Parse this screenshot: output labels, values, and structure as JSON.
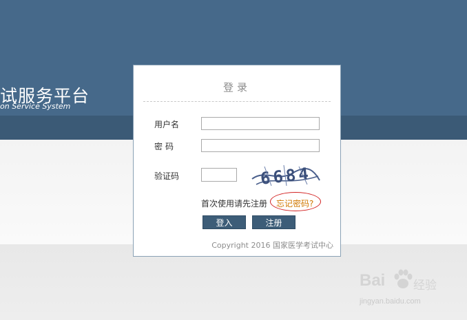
{
  "header": {
    "title_visible": "试服务平台",
    "subtitle_visible": "on Service System"
  },
  "login": {
    "title": "登录",
    "username_label": "用户名",
    "username_value": "",
    "password_label": "密码",
    "password_value": "",
    "captcha_label": "验证码",
    "captcha_value": "",
    "captcha_text": "6684",
    "register_hint": "首次使用请先注册",
    "forgot_password": "忘记密码?",
    "login_button": "登入",
    "register_button": "注册",
    "copyright": "Copyright 2016 国家医学考试中心"
  },
  "watermark": {
    "brand": "Bai  ",
    "brand_cn": "经验",
    "url": "jingyan.baidu.com"
  },
  "colors": {
    "header_bg": "#46698a",
    "button_bg": "#3d5d78",
    "link": "#d07800",
    "highlight_ring": "#d22020"
  }
}
